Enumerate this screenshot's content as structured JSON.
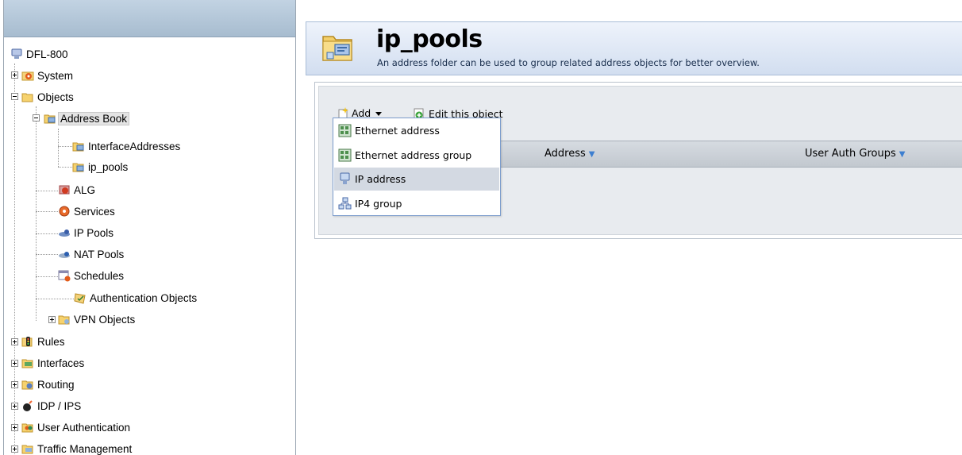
{
  "nav": {
    "tree": [
      {
        "label": "DFL-800"
      },
      {
        "label": "System"
      },
      {
        "label": "Objects"
      },
      {
        "label": "Address Book"
      },
      {
        "label": "InterfaceAddresses"
      },
      {
        "label": "ip_pools"
      },
      {
        "label": "ALG"
      },
      {
        "label": "Services"
      },
      {
        "label": "IP Pools"
      },
      {
        "label": "NAT Pools"
      },
      {
        "label": "Schedules"
      },
      {
        "label": "Authentication Objects"
      },
      {
        "label": "VPN Objects"
      },
      {
        "label": "Rules"
      },
      {
        "label": "Interfaces"
      },
      {
        "label": "Routing"
      },
      {
        "label": "IDP / IPS"
      },
      {
        "label": "User Authentication"
      },
      {
        "label": "Traffic Management"
      }
    ]
  },
  "header": {
    "title": "ip_pools",
    "description": "An address folder can be used to group related address objects for better overview."
  },
  "toolbar": {
    "add_label": "Add",
    "edit_label": "Edit this object"
  },
  "grid": {
    "columns": [
      {
        "label": "Address"
      },
      {
        "label": "User Auth Groups"
      }
    ]
  },
  "add_menu": {
    "items": [
      {
        "label": "Ethernet address"
      },
      {
        "label": "Ethernet address group"
      },
      {
        "label": "IP address"
      },
      {
        "label": "IP4 group"
      }
    ],
    "highlighted_item": "IP address"
  },
  "colors": {
    "header_gradient_top": "#eef3fb",
    "header_gradient_bottom": "#d2def0",
    "menu_border": "#7b9ccc",
    "menu_hover": "#d3d9e2",
    "sort_arrow": "#3d7fd0"
  }
}
